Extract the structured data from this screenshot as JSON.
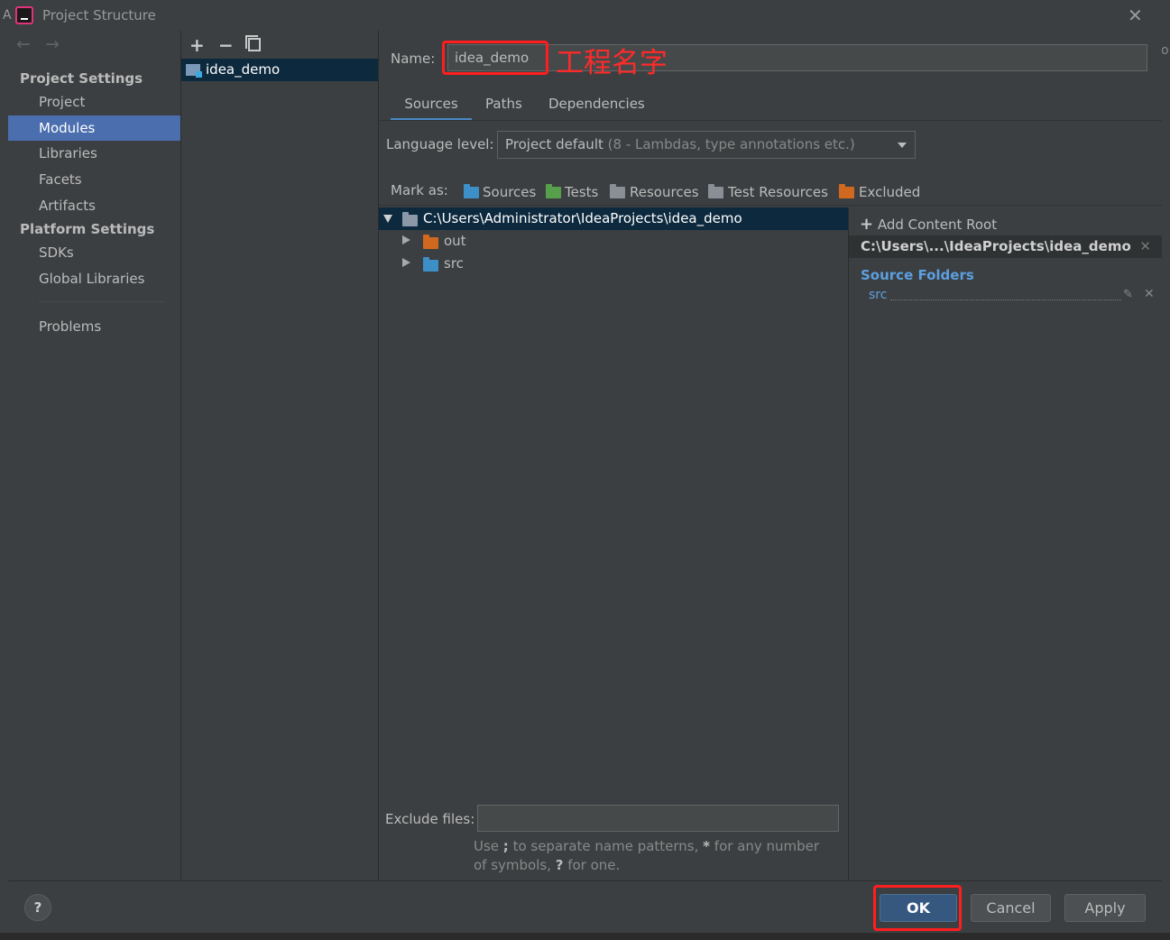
{
  "window": {
    "title": "Project Structure",
    "edge_glyph": "A",
    "right_edge_glyph": "o"
  },
  "leftnav": {
    "back_arrow": "←",
    "forward_arrow": "→",
    "project_settings_header": "Project Settings",
    "platform_settings_header": "Platform Settings",
    "items": [
      {
        "label": "Project",
        "selected": false
      },
      {
        "label": "Modules",
        "selected": true
      },
      {
        "label": "Libraries",
        "selected": false
      },
      {
        "label": "Facets",
        "selected": false
      },
      {
        "label": "Artifacts",
        "selected": false
      },
      {
        "label": "SDKs",
        "selected": false
      },
      {
        "label": "Global Libraries",
        "selected": false
      },
      {
        "label": "Problems",
        "selected": false
      }
    ]
  },
  "modules": {
    "add_glyph": "+",
    "remove_glyph": "−",
    "selected_module": "idea_demo"
  },
  "main": {
    "name_label": "Name:",
    "name_value": "idea_demo",
    "annotation": "工程名字",
    "tabs": [
      {
        "label": "Sources",
        "active": true
      },
      {
        "label": "Paths",
        "active": false
      },
      {
        "label": "Dependencies",
        "active": false
      }
    ],
    "language_label": "Language level:",
    "language_value": "Project default",
    "language_detail": "(8 - Lambdas, type annotations etc.)",
    "mark_label": "Mark as:",
    "mark_buttons": [
      {
        "label": "Sources",
        "color": "#3d8fc8"
      },
      {
        "label": "Tests",
        "color": "#57a04b"
      },
      {
        "label": "Resources",
        "color": "#8a8f96"
      },
      {
        "label": "Test Resources",
        "color": "#8a8f96"
      },
      {
        "label": "Excluded",
        "color": "#d0691f"
      }
    ],
    "tree": {
      "root": "C:\\Users\\Administrator\\IdeaProjects\\idea_demo",
      "children": [
        {
          "label": "out",
          "color": "#d0691f"
        },
        {
          "label": "src",
          "color": "#3d8fc8"
        }
      ]
    },
    "exclude_label": "Exclude files:",
    "exclude_value": "",
    "hint_part1": "Use ",
    "hint_bold1": ";",
    "hint_part2": " to separate name patterns, ",
    "hint_bold2": "*",
    "hint_part3": " for any number of symbols, ",
    "hint_bold3": "?",
    "hint_part4": " for one."
  },
  "content_root": {
    "add_label": "Add Content Root",
    "root_path": "C:\\Users\\...\\IdeaProjects\\idea_demo",
    "source_folders_header": "Source Folders",
    "source_folder": "src"
  },
  "buttons": {
    "help": "?",
    "ok": "OK",
    "cancel": "Cancel",
    "apply": "Apply"
  },
  "colors": {
    "selection": "#4b6eaf",
    "tree_selection": "#0d293e",
    "highlight": "#ff1d1d",
    "link": "#5c9fe0"
  }
}
